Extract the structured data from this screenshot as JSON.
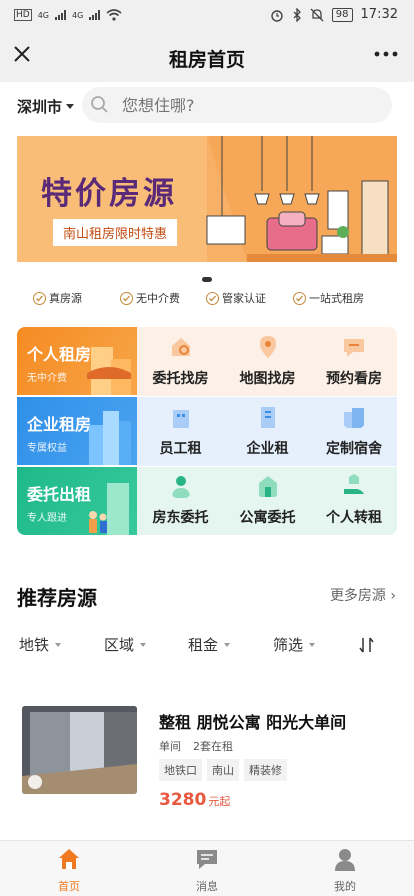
{
  "status_bar": {
    "network_label": "HD",
    "signal1": "4G",
    "signal2": "4G",
    "battery": "98",
    "time": "17:32"
  },
  "nav": {
    "title": "租房首页"
  },
  "search": {
    "city": "深圳市",
    "placeholder": "您想住哪?"
  },
  "banner": {
    "title": "特价房源",
    "subtitle": "南山租房限时特惠"
  },
  "features": [
    "真房源",
    "无中介费",
    "管家认证",
    "一站式租房"
  ],
  "services": {
    "rows": [
      {
        "title": "个人租房",
        "subtitle": "无中介费",
        "items": [
          "委托找房",
          "地图找房",
          "预约看房"
        ]
      },
      {
        "title": "企业租房",
        "subtitle": "专属权益",
        "items": [
          "员工租",
          "企业租",
          "定制宿舍"
        ]
      },
      {
        "title": "委托出租",
        "subtitle": "专人跟进",
        "items": [
          "房东委托",
          "公寓委托",
          "个人转租"
        ]
      }
    ]
  },
  "recommend": {
    "title": "推荐房源",
    "more": "更多房源"
  },
  "filters": [
    "地铁",
    "区域",
    "租金",
    "筛选"
  ],
  "listing": {
    "title": "整租 朋悦公寓 阳光大单间",
    "meta": [
      "单间",
      "2套在租"
    ],
    "tags": [
      "地铁口",
      "南山",
      "精装修"
    ],
    "price": "3280",
    "price_unit": "元起"
  },
  "tabbar": [
    "首页",
    "消息",
    "我的"
  ],
  "colors": {
    "accent": "#f07a22",
    "price": "#e8573e",
    "row1": "#f58b22",
    "row2": "#2f8fe8",
    "row3": "#23c08f"
  }
}
